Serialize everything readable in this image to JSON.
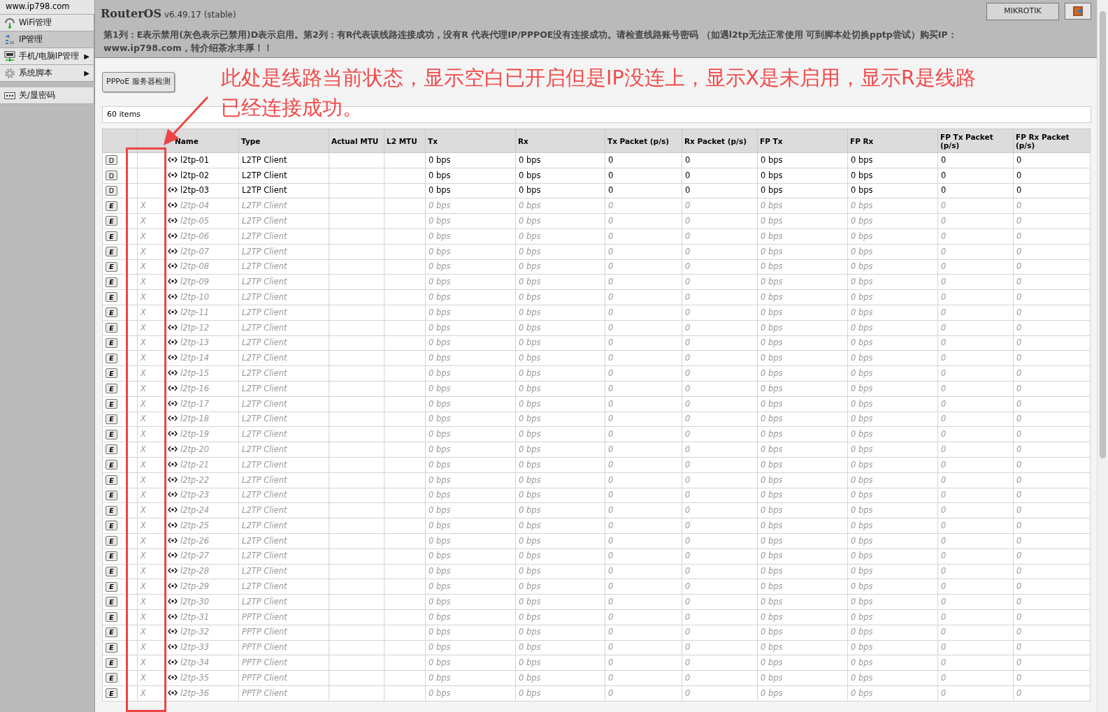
{
  "sidebar": {
    "site": "www.ip798.com",
    "sections": [
      [
        {
          "label": "WiFi管理",
          "selected": false
        },
        {
          "label": "IP管理",
          "selected": true
        },
        {
          "label": "手机/电脑IP管理",
          "arrow": "▶",
          "selected": false
        },
        {
          "label": "系统脚本",
          "arrow": "▶",
          "selected": false
        }
      ],
      [
        {
          "label": "关/显密码",
          "selected": false
        }
      ]
    ]
  },
  "header": {
    "product": "RouterOS",
    "version": "v6.49.17 (stable)",
    "user_button": "MIKROTIK",
    "notice": "第1列：E表示禁用(灰色表示已禁用)D表示启用。第2列：有R代表该线路连接成功，没有R 代表代理IP/PPPOE没有连接成功。请检查线路账号密码 （如遇l2tp无法正常使用 可到脚本处切换pptp尝试）购买IP：www.ip798.com，转介绍茶水丰厚！！"
  },
  "toolbar": {
    "button": "PPPoE 服务器检测"
  },
  "annotation": "此处是线路当前状态，显示空白已开启但是IP没连上，显示X是未启用，显示R是线路已经连接成功。",
  "table": {
    "count": "60 items",
    "columns": [
      "",
      "",
      "Name",
      "Type",
      "Actual MTU",
      "L2 MTU",
      "Tx",
      "Rx",
      "Tx Packet (p/s)",
      "Rx Packet (p/s)",
      "FP Tx",
      "FP Rx",
      "FP Tx Packet (p/s)",
      "FP Rx Packet (p/s)"
    ],
    "rows": [
      {
        "toggle": "D",
        "disabled": false,
        "name": "l2tp-01",
        "type": "L2TP Client",
        "tx": "0 bps",
        "rx": "0 bps",
        "tx_packet": "0",
        "rx_packet": "0",
        "fp_tx": "0 bps",
        "fp_rx": "0 bps",
        "fp_tx_packet": "0",
        "fp_rx_packet": "0"
      },
      {
        "toggle": "D",
        "disabled": false,
        "name": "l2tp-02",
        "type": "L2TP Client",
        "tx": "0 bps",
        "rx": "0 bps",
        "tx_packet": "0",
        "rx_packet": "0",
        "fp_tx": "0 bps",
        "fp_rx": "0 bps",
        "fp_tx_packet": "0",
        "fp_rx_packet": "0"
      },
      {
        "toggle": "D",
        "disabled": false,
        "name": "l2tp-03",
        "type": "L2TP Client",
        "tx": "0 bps",
        "rx": "0 bps",
        "tx_packet": "0",
        "rx_packet": "0",
        "fp_tx": "0 bps",
        "fp_rx": "0 bps",
        "fp_tx_packet": "0",
        "fp_rx_packet": "0"
      },
      {
        "toggle": "E",
        "disabled": true,
        "status": "X",
        "name": "l2tp-04",
        "type": "L2TP Client",
        "tx": "0 bps",
        "rx": "0 bps",
        "tx_packet": "0",
        "rx_packet": "0",
        "fp_tx": "0 bps",
        "fp_rx": "0 bps",
        "fp_tx_packet": "0",
        "fp_rx_packet": "0"
      },
      {
        "toggle": "E",
        "disabled": true,
        "status": "X",
        "name": "l2tp-05",
        "type": "L2TP Client",
        "tx": "0 bps",
        "rx": "0 bps",
        "tx_packet": "0",
        "rx_packet": "0",
        "fp_tx": "0 bps",
        "fp_rx": "0 bps",
        "fp_tx_packet": "0",
        "fp_rx_packet": "0"
      },
      {
        "toggle": "E",
        "disabled": true,
        "status": "X",
        "name": "l2tp-06",
        "type": "L2TP Client",
        "tx": "0 bps",
        "rx": "0 bps",
        "tx_packet": "0",
        "rx_packet": "0",
        "fp_tx": "0 bps",
        "fp_rx": "0 bps",
        "fp_tx_packet": "0",
        "fp_rx_packet": "0"
      },
      {
        "toggle": "E",
        "disabled": true,
        "status": "X",
        "name": "l2tp-07",
        "type": "L2TP Client",
        "tx": "0 bps",
        "rx": "0 bps",
        "tx_packet": "0",
        "rx_packet": "0",
        "fp_tx": "0 bps",
        "fp_rx": "0 bps",
        "fp_tx_packet": "0",
        "fp_rx_packet": "0"
      },
      {
        "toggle": "E",
        "disabled": true,
        "status": "X",
        "name": "l2tp-08",
        "type": "L2TP Client",
        "tx": "0 bps",
        "rx": "0 bps",
        "tx_packet": "0",
        "rx_packet": "0",
        "fp_tx": "0 bps",
        "fp_rx": "0 bps",
        "fp_tx_packet": "0",
        "fp_rx_packet": "0"
      },
      {
        "toggle": "E",
        "disabled": true,
        "status": "X",
        "name": "l2tp-09",
        "type": "L2TP Client",
        "tx": "0 bps",
        "rx": "0 bps",
        "tx_packet": "0",
        "rx_packet": "0",
        "fp_tx": "0 bps",
        "fp_rx": "0 bps",
        "fp_tx_packet": "0",
        "fp_rx_packet": "0"
      },
      {
        "toggle": "E",
        "disabled": true,
        "status": "X",
        "name": "l2tp-10",
        "type": "L2TP Client",
        "tx": "0 bps",
        "rx": "0 bps",
        "tx_packet": "0",
        "rx_packet": "0",
        "fp_tx": "0 bps",
        "fp_rx": "0 bps",
        "fp_tx_packet": "0",
        "fp_rx_packet": "0"
      },
      {
        "toggle": "E",
        "disabled": true,
        "status": "X",
        "name": "l2tp-11",
        "type": "L2TP Client",
        "tx": "0 bps",
        "rx": "0 bps",
        "tx_packet": "0",
        "rx_packet": "0",
        "fp_tx": "0 bps",
        "fp_rx": "0 bps",
        "fp_tx_packet": "0",
        "fp_rx_packet": "0"
      },
      {
        "toggle": "E",
        "disabled": true,
        "status": "X",
        "name": "l2tp-12",
        "type": "L2TP Client",
        "tx": "0 bps",
        "rx": "0 bps",
        "tx_packet": "0",
        "rx_packet": "0",
        "fp_tx": "0 bps",
        "fp_rx": "0 bps",
        "fp_tx_packet": "0",
        "fp_rx_packet": "0"
      },
      {
        "toggle": "E",
        "disabled": true,
        "status": "X",
        "name": "l2tp-13",
        "type": "L2TP Client",
        "tx": "0 bps",
        "rx": "0 bps",
        "tx_packet": "0",
        "rx_packet": "0",
        "fp_tx": "0 bps",
        "fp_rx": "0 bps",
        "fp_tx_packet": "0",
        "fp_rx_packet": "0"
      },
      {
        "toggle": "E",
        "disabled": true,
        "status": "X",
        "name": "l2tp-14",
        "type": "L2TP Client",
        "tx": "0 bps",
        "rx": "0 bps",
        "tx_packet": "0",
        "rx_packet": "0",
        "fp_tx": "0 bps",
        "fp_rx": "0 bps",
        "fp_tx_packet": "0",
        "fp_rx_packet": "0"
      },
      {
        "toggle": "E",
        "disabled": true,
        "status": "X",
        "name": "l2tp-15",
        "type": "L2TP Client",
        "tx": "0 bps",
        "rx": "0 bps",
        "tx_packet": "0",
        "rx_packet": "0",
        "fp_tx": "0 bps",
        "fp_rx": "0 bps",
        "fp_tx_packet": "0",
        "fp_rx_packet": "0"
      },
      {
        "toggle": "E",
        "disabled": true,
        "status": "X",
        "name": "l2tp-16",
        "type": "L2TP Client",
        "tx": "0 bps",
        "rx": "0 bps",
        "tx_packet": "0",
        "rx_packet": "0",
        "fp_tx": "0 bps",
        "fp_rx": "0 bps",
        "fp_tx_packet": "0",
        "fp_rx_packet": "0"
      },
      {
        "toggle": "E",
        "disabled": true,
        "status": "X",
        "name": "l2tp-17",
        "type": "L2TP Client",
        "tx": "0 bps",
        "rx": "0 bps",
        "tx_packet": "0",
        "rx_packet": "0",
        "fp_tx": "0 bps",
        "fp_rx": "0 bps",
        "fp_tx_packet": "0",
        "fp_rx_packet": "0"
      },
      {
        "toggle": "E",
        "disabled": true,
        "status": "X",
        "name": "l2tp-18",
        "type": "L2TP Client",
        "tx": "0 bps",
        "rx": "0 bps",
        "tx_packet": "0",
        "rx_packet": "0",
        "fp_tx": "0 bps",
        "fp_rx": "0 bps",
        "fp_tx_packet": "0",
        "fp_rx_packet": "0"
      },
      {
        "toggle": "E",
        "disabled": true,
        "status": "X",
        "name": "l2tp-19",
        "type": "L2TP Client",
        "tx": "0 bps",
        "rx": "0 bps",
        "tx_packet": "0",
        "rx_packet": "0",
        "fp_tx": "0 bps",
        "fp_rx": "0 bps",
        "fp_tx_packet": "0",
        "fp_rx_packet": "0"
      },
      {
        "toggle": "E",
        "disabled": true,
        "status": "X",
        "name": "l2tp-20",
        "type": "L2TP Client",
        "tx": "0 bps",
        "rx": "0 bps",
        "tx_packet": "0",
        "rx_packet": "0",
        "fp_tx": "0 bps",
        "fp_rx": "0 bps",
        "fp_tx_packet": "0",
        "fp_rx_packet": "0"
      },
      {
        "toggle": "E",
        "disabled": true,
        "status": "X",
        "name": "l2tp-21",
        "type": "L2TP Client",
        "tx": "0 bps",
        "rx": "0 bps",
        "tx_packet": "0",
        "rx_packet": "0",
        "fp_tx": "0 bps",
        "fp_rx": "0 bps",
        "fp_tx_packet": "0",
        "fp_rx_packet": "0"
      },
      {
        "toggle": "E",
        "disabled": true,
        "status": "X",
        "name": "l2tp-22",
        "type": "L2TP Client",
        "tx": "0 bps",
        "rx": "0 bps",
        "tx_packet": "0",
        "rx_packet": "0",
        "fp_tx": "0 bps",
        "fp_rx": "0 bps",
        "fp_tx_packet": "0",
        "fp_rx_packet": "0"
      },
      {
        "toggle": "E",
        "disabled": true,
        "status": "X",
        "name": "l2tp-23",
        "type": "L2TP Client",
        "tx": "0 bps",
        "rx": "0 bps",
        "tx_packet": "0",
        "rx_packet": "0",
        "fp_tx": "0 bps",
        "fp_rx": "0 bps",
        "fp_tx_packet": "0",
        "fp_rx_packet": "0"
      },
      {
        "toggle": "E",
        "disabled": true,
        "status": "X",
        "name": "l2tp-24",
        "type": "L2TP Client",
        "tx": "0 bps",
        "rx": "0 bps",
        "tx_packet": "0",
        "rx_packet": "0",
        "fp_tx": "0 bps",
        "fp_rx": "0 bps",
        "fp_tx_packet": "0",
        "fp_rx_packet": "0"
      },
      {
        "toggle": "E",
        "disabled": true,
        "status": "X",
        "name": "l2tp-25",
        "type": "L2TP Client",
        "tx": "0 bps",
        "rx": "0 bps",
        "tx_packet": "0",
        "rx_packet": "0",
        "fp_tx": "0 bps",
        "fp_rx": "0 bps",
        "fp_tx_packet": "0",
        "fp_rx_packet": "0"
      },
      {
        "toggle": "E",
        "disabled": true,
        "status": "X",
        "name": "l2tp-26",
        "type": "L2TP Client",
        "tx": "0 bps",
        "rx": "0 bps",
        "tx_packet": "0",
        "rx_packet": "0",
        "fp_tx": "0 bps",
        "fp_rx": "0 bps",
        "fp_tx_packet": "0",
        "fp_rx_packet": "0"
      },
      {
        "toggle": "E",
        "disabled": true,
        "status": "X",
        "name": "l2tp-27",
        "type": "L2TP Client",
        "tx": "0 bps",
        "rx": "0 bps",
        "tx_packet": "0",
        "rx_packet": "0",
        "fp_tx": "0 bps",
        "fp_rx": "0 bps",
        "fp_tx_packet": "0",
        "fp_rx_packet": "0"
      },
      {
        "toggle": "E",
        "disabled": true,
        "status": "X",
        "name": "l2tp-28",
        "type": "L2TP Client",
        "tx": "0 bps",
        "rx": "0 bps",
        "tx_packet": "0",
        "rx_packet": "0",
        "fp_tx": "0 bps",
        "fp_rx": "0 bps",
        "fp_tx_packet": "0",
        "fp_rx_packet": "0"
      },
      {
        "toggle": "E",
        "disabled": true,
        "status": "X",
        "name": "l2tp-29",
        "type": "L2TP Client",
        "tx": "0 bps",
        "rx": "0 bps",
        "tx_packet": "0",
        "rx_packet": "0",
        "fp_tx": "0 bps",
        "fp_rx": "0 bps",
        "fp_tx_packet": "0",
        "fp_rx_packet": "0"
      },
      {
        "toggle": "E",
        "disabled": true,
        "status": "X",
        "name": "l2tp-30",
        "type": "L2TP Client",
        "tx": "0 bps",
        "rx": "0 bps",
        "tx_packet": "0",
        "rx_packet": "0",
        "fp_tx": "0 bps",
        "fp_rx": "0 bps",
        "fp_tx_packet": "0",
        "fp_rx_packet": "0"
      },
      {
        "toggle": "E",
        "disabled": true,
        "status": "X",
        "name": "l2tp-31",
        "type": "PPTP Client",
        "tx": "0 bps",
        "rx": "0 bps",
        "tx_packet": "0",
        "rx_packet": "0",
        "fp_tx": "0 bps",
        "fp_rx": "0 bps",
        "fp_tx_packet": "0",
        "fp_rx_packet": "0"
      },
      {
        "toggle": "E",
        "disabled": true,
        "status": "X",
        "name": "l2tp-32",
        "type": "PPTP Client",
        "tx": "0 bps",
        "rx": "0 bps",
        "tx_packet": "0",
        "rx_packet": "0",
        "fp_tx": "0 bps",
        "fp_rx": "0 bps",
        "fp_tx_packet": "0",
        "fp_rx_packet": "0"
      },
      {
        "toggle": "E",
        "disabled": true,
        "status": "X",
        "name": "l2tp-33",
        "type": "PPTP Client",
        "tx": "0 bps",
        "rx": "0 bps",
        "tx_packet": "0",
        "rx_packet": "0",
        "fp_tx": "0 bps",
        "fp_rx": "0 bps",
        "fp_tx_packet": "0",
        "fp_rx_packet": "0"
      },
      {
        "toggle": "E",
        "disabled": true,
        "status": "X",
        "name": "l2tp-34",
        "type": "PPTP Client",
        "tx": "0 bps",
        "rx": "0 bps",
        "tx_packet": "0",
        "rx_packet": "0",
        "fp_tx": "0 bps",
        "fp_rx": "0 bps",
        "fp_tx_packet": "0",
        "fp_rx_packet": "0"
      },
      {
        "toggle": "E",
        "disabled": true,
        "status": "X",
        "name": "l2tp-35",
        "type": "PPTP Client",
        "tx": "0 bps",
        "rx": "0 bps",
        "tx_packet": "0",
        "rx_packet": "0",
        "fp_tx": "0 bps",
        "fp_rx": "0 bps",
        "fp_tx_packet": "0",
        "fp_rx_packet": "0"
      },
      {
        "toggle": "E",
        "disabled": true,
        "status": "X",
        "name": "l2tp-36",
        "type": "PPTP Client",
        "tx": "0 bps",
        "rx": "0 bps",
        "tx_packet": "0",
        "rx_packet": "0",
        "fp_tx": "0 bps",
        "fp_rx": "0 bps",
        "fp_tx_packet": "0",
        "fp_rx_packet": "0"
      }
    ]
  }
}
